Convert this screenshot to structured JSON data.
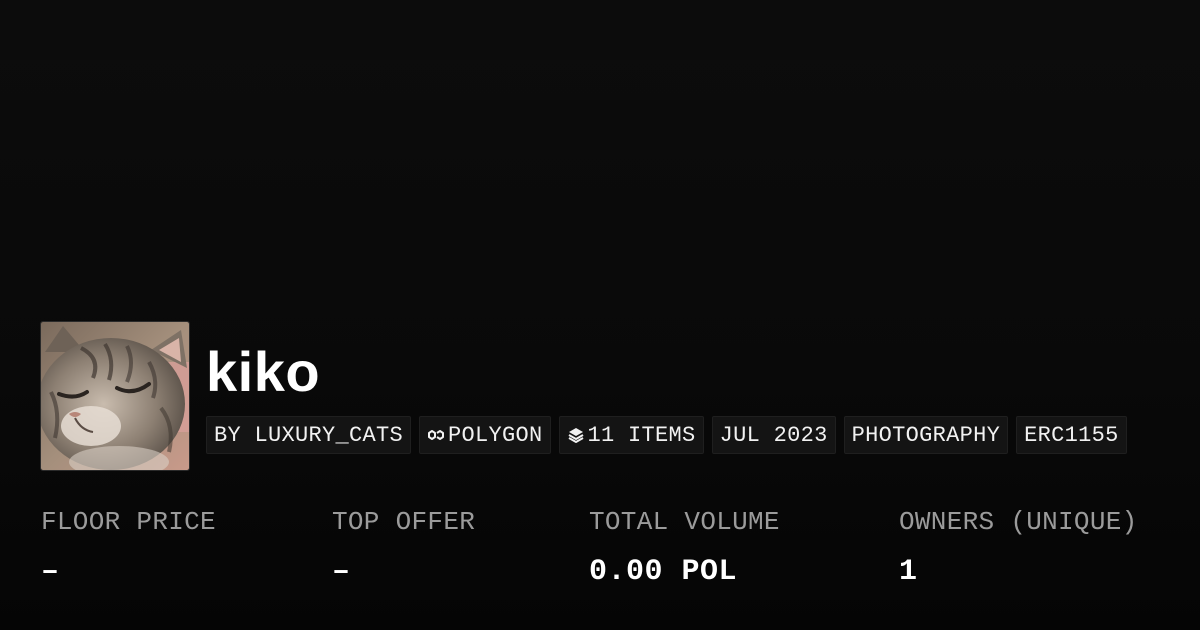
{
  "collection": {
    "name": "kiko",
    "avatar_icon": "cat-photo"
  },
  "chips": [
    {
      "label": "BY LUXURY_CATS",
      "icon": null
    },
    {
      "label": "POLYGON",
      "icon": "polygon-icon"
    },
    {
      "label": "11 ITEMS",
      "icon": "layers-icon"
    },
    {
      "label": "JUL 2023",
      "icon": null
    },
    {
      "label": "PHOTOGRAPHY",
      "icon": null
    },
    {
      "label": "ERC1155",
      "icon": null
    }
  ],
  "stats": [
    {
      "label": "FLOOR PRICE",
      "value": "–"
    },
    {
      "label": "TOP OFFER",
      "value": "–"
    },
    {
      "label": "TOTAL VOLUME",
      "value": "0.00 POL"
    },
    {
      "label": "OWNERS (UNIQUE)",
      "value": "1"
    }
  ],
  "colors": {
    "background": "#0b0b0b",
    "chip_background": "#141414",
    "label": "#9b9b9b",
    "text": "#ffffff"
  }
}
